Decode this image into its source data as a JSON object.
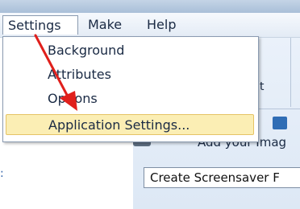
{
  "menubar": {
    "items": [
      {
        "label": "Settings"
      },
      {
        "label": "Make"
      },
      {
        "label": "Help"
      }
    ]
  },
  "settings_menu": {
    "items": [
      {
        "label": "Background"
      },
      {
        "label": "Attributes"
      },
      {
        "label": "Options"
      },
      {
        "label": "Application Settings..."
      }
    ],
    "highlighted_index": 3
  },
  "background_window": {
    "add_images_text": "Add your Imag",
    "create_button_text": "Create Screensaver F",
    "partial_label": "t"
  },
  "annotation": {
    "arrow_color": "#e0201c"
  }
}
